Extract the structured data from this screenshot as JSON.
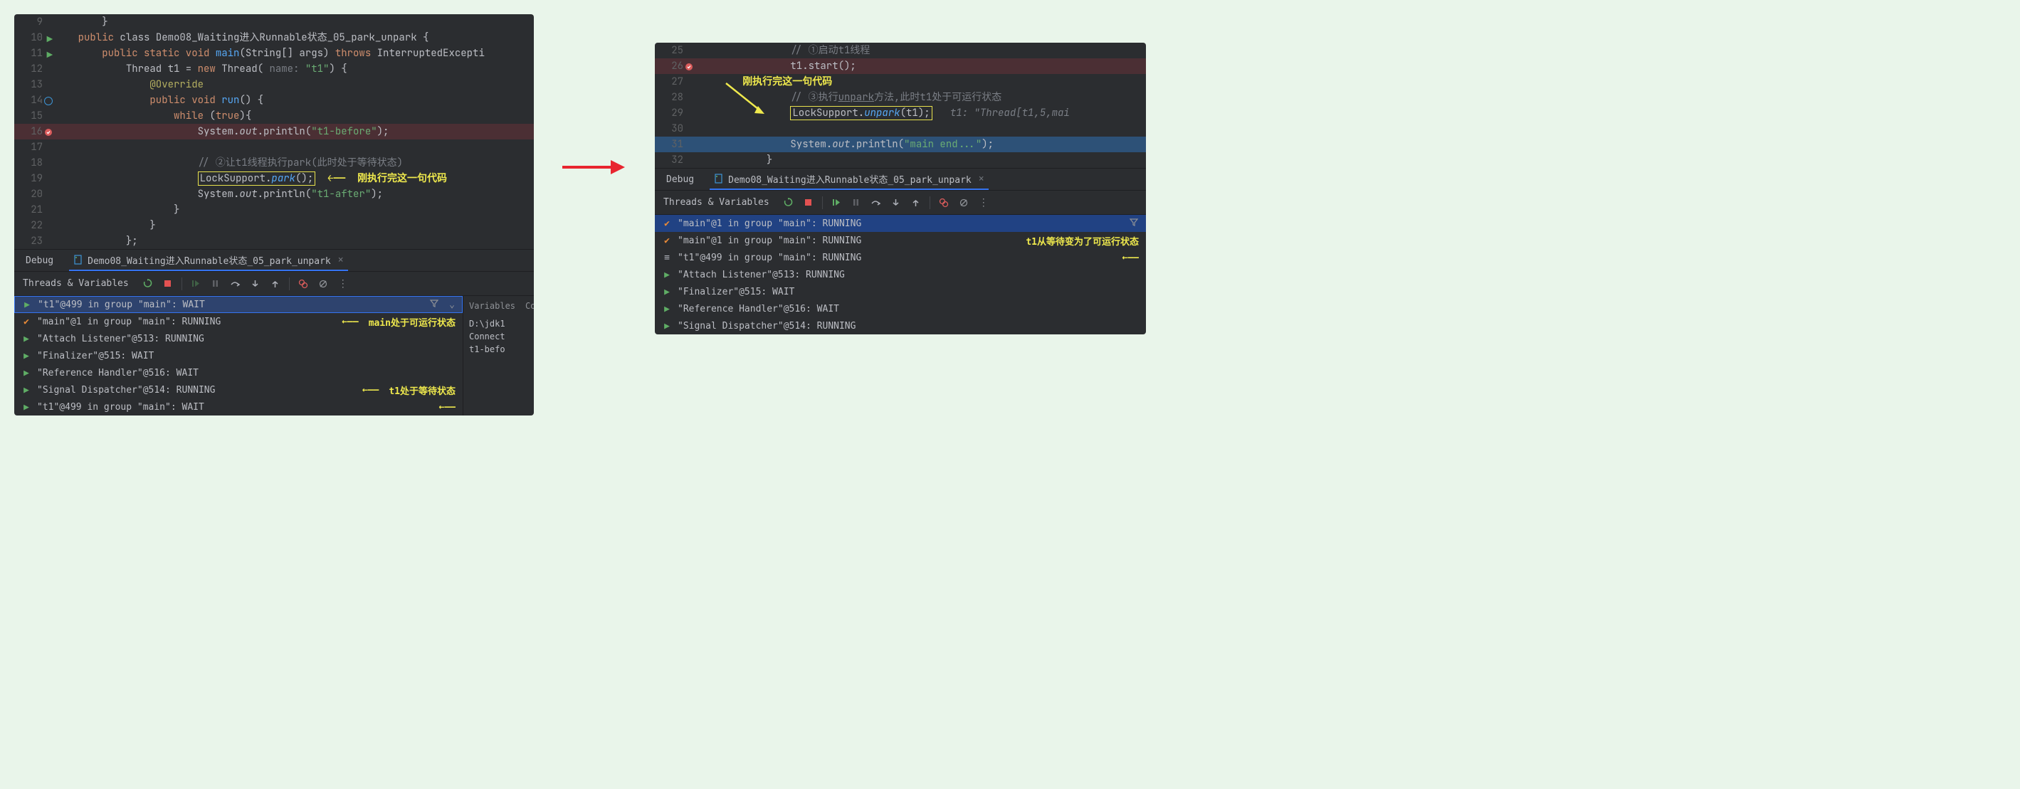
{
  "left": {
    "code": {
      "lines": [
        {
          "n": "9",
          "indent": 2,
          "segs": [
            {
              "t": "}"
            }
          ]
        },
        {
          "n": "10",
          "icon": "run",
          "indent": 1,
          "segs": [
            {
              "t": "public ",
              "c": "kw"
            },
            {
              "t": "class "
            },
            {
              "t": "Demo08_Waiting进入Runnable状态_05_park_unpark {",
              "c": ""
            }
          ]
        },
        {
          "n": "11",
          "icon": "run",
          "indent": 2,
          "segs": [
            {
              "t": "public static void ",
              "c": "kw"
            },
            {
              "t": "main",
              "c": "method"
            },
            {
              "t": "(String[] args) "
            },
            {
              "t": "throws ",
              "c": "kw"
            },
            {
              "t": "InterruptedExcepti",
              "c": ""
            }
          ]
        },
        {
          "n": "12",
          "indent": 3,
          "segs": [
            {
              "t": "Thread t1 = "
            },
            {
              "t": "new ",
              "c": "kw"
            },
            {
              "t": "Thread("
            },
            {
              "t": " name: ",
              "c": "param-hint"
            },
            {
              "t": "\"t1\"",
              "c": "str"
            },
            {
              "t": ") {"
            }
          ]
        },
        {
          "n": "13",
          "indent": 4,
          "segs": [
            {
              "t": "@Override",
              "c": "anno"
            }
          ]
        },
        {
          "n": "14",
          "icon": "target",
          "indent": 4,
          "segs": [
            {
              "t": "public void ",
              "c": "kw"
            },
            {
              "t": "run",
              "c": "method"
            },
            {
              "t": "() {"
            }
          ]
        },
        {
          "n": "15",
          "indent": 5,
          "segs": [
            {
              "t": "while ",
              "c": "kw"
            },
            {
              "t": "("
            },
            {
              "t": "true",
              "c": "kw"
            },
            {
              "t": "){"
            }
          ]
        },
        {
          "n": "16",
          "icon": "bp",
          "bp": true,
          "indent": 6,
          "segs": [
            {
              "t": "System."
            },
            {
              "t": "out",
              "c": "italic"
            },
            {
              "t": ".println("
            },
            {
              "t": "\"t1-before\"",
              "c": "str"
            },
            {
              "t": ");"
            }
          ]
        },
        {
          "n": "17",
          "indent": 0,
          "segs": []
        },
        {
          "n": "18",
          "indent": 6,
          "segs": [
            {
              "t": "// ②让t1线程执行park(此时处于等待状态)",
              "c": "comment"
            }
          ]
        },
        {
          "n": "19",
          "indent": 6,
          "segs": [
            {
              "t": "LockSupport.",
              "boxstart": true
            },
            {
              "t": "park",
              "c": "italic method"
            },
            {
              "t": "();",
              "boxend": true
            },
            {
              "t": "  "
            },
            {
              "t": "←——",
              "c": "yellow-arrow"
            },
            {
              "t": "  "
            },
            {
              "t": "刚执行完这一句代码",
              "c": "annotation-text"
            }
          ],
          "boxed": true
        },
        {
          "n": "20",
          "indent": 6,
          "segs": [
            {
              "t": "System."
            },
            {
              "t": "out",
              "c": "italic"
            },
            {
              "t": ".println("
            },
            {
              "t": "\"t1-after\"",
              "c": "str"
            },
            {
              "t": ");"
            }
          ]
        },
        {
          "n": "21",
          "indent": 5,
          "segs": [
            {
              "t": "}"
            }
          ]
        },
        {
          "n": "22",
          "indent": 4,
          "segs": [
            {
              "t": "}"
            }
          ]
        },
        {
          "n": "23",
          "indent": 3,
          "segs": [
            {
              "t": "};"
            }
          ]
        }
      ]
    },
    "debugTab": {
      "label": "Debug",
      "file": "Demo08_Waiting进入Runnable状态_05_park_unpark"
    },
    "tvLabel": "Threads & Variables",
    "threads": [
      {
        "icon": "run",
        "text": "\"t1\"@499 in group \"main\": WAIT",
        "selected": true,
        "filter": true
      },
      {
        "icon": "sus",
        "text": "\"main\"@1 in group \"main\": RUNNING",
        "anno": "main处于可运行状态"
      },
      {
        "icon": "run",
        "text": "\"Attach Listener\"@513: RUNNING"
      },
      {
        "icon": "run",
        "text": "\"Finalizer\"@515: WAIT"
      },
      {
        "icon": "run",
        "text": "\"Reference Handler\"@516: WAIT"
      },
      {
        "icon": "run",
        "text": "\"Signal Dispatcher\"@514: RUNNING",
        "anno": "t1处于等待状态",
        "annoOffset": true
      },
      {
        "icon": "run",
        "text": "\"t1\"@499 in group \"main\": WAIT",
        "arrow": true
      }
    ],
    "sideTabs": {
      "variables": "Variables",
      "console": "Conso"
    },
    "consoleLines": [
      "D:\\jdk1",
      "Connect",
      "t1-befo"
    ]
  },
  "right": {
    "code": {
      "lines": [
        {
          "n": "25",
          "indent": 4,
          "segs": [
            {
              "t": "// ①启动t1线程",
              "c": "comment"
            }
          ]
        },
        {
          "n": "26",
          "icon": "bp",
          "bp": true,
          "indent": 4,
          "segs": [
            {
              "t": "t1.start();"
            }
          ]
        },
        {
          "n": "27",
          "indent": 2,
          "segs": [
            {
              "t": "刚执行完这一句代码",
              "c": "annotation-text"
            }
          ],
          "anno": true
        },
        {
          "n": "28",
          "indent": 4,
          "segs": [
            {
              "t": "// ③执行",
              "c": "comment"
            },
            {
              "t": "unpark",
              "c": "comment",
              "u": true
            },
            {
              "t": "方法,此时t1处于可运行状态",
              "c": "comment"
            }
          ]
        },
        {
          "n": "29",
          "indent": 4,
          "segs": [
            {
              "t": "LockSupport.",
              "boxstart": true
            },
            {
              "t": "unpark",
              "c": "italic method"
            },
            {
              "t": "(t1);",
              "boxend": true
            },
            {
              "t": "   "
            },
            {
              "t": "t1: \"Thread[t1,5,mai",
              "c": "comment italic"
            }
          ],
          "boxed": true
        },
        {
          "n": "30",
          "indent": 0,
          "segs": []
        },
        {
          "n": "31",
          "exe": true,
          "indent": 4,
          "segs": [
            {
              "t": "System."
            },
            {
              "t": "out",
              "c": "italic"
            },
            {
              "t": ".println("
            },
            {
              "t": "\"main end...\"",
              "c": "str"
            },
            {
              "t": ");"
            }
          ]
        },
        {
          "n": "32",
          "indent": 3,
          "segs": [
            {
              "t": "}"
            }
          ]
        }
      ]
    },
    "debugTab": {
      "label": "Debug",
      "file": "Demo08_Waiting进入Runnable状态_05_park_unpark"
    },
    "tvLabel": "Threads & Variables",
    "threads": [
      {
        "icon": "sus",
        "text": "\"main\"@1 in group \"main\": RUNNING",
        "selectedMain": true,
        "filter": true
      },
      {
        "icon": "sus",
        "text": "\"main\"@1 in group \"main\": RUNNING",
        "anno": "t1从等待变为了可运行状态",
        "annoRight": true
      },
      {
        "icon": "pause",
        "text": "\"t1\"@499 in group \"main\": RUNNING",
        "arrow": true
      },
      {
        "icon": "run",
        "text": "\"Attach Listener\"@513: RUNNING"
      },
      {
        "icon": "run",
        "text": "\"Finalizer\"@515: WAIT"
      },
      {
        "icon": "run",
        "text": "\"Reference Handler\"@516: WAIT"
      },
      {
        "icon": "run",
        "text": "\"Signal Dispatcher\"@514: RUNNING"
      }
    ]
  },
  "colors": {
    "bg": "#2b2d30",
    "pageBg": "#e9f5ea",
    "keyword": "#cf8e6d",
    "method": "#56a8f5",
    "string": "#6aab73",
    "comment": "#7a7e85",
    "annotation": "#efe94d",
    "breakpointLine": "#4b2f34",
    "executeLine": "#2d5177"
  }
}
